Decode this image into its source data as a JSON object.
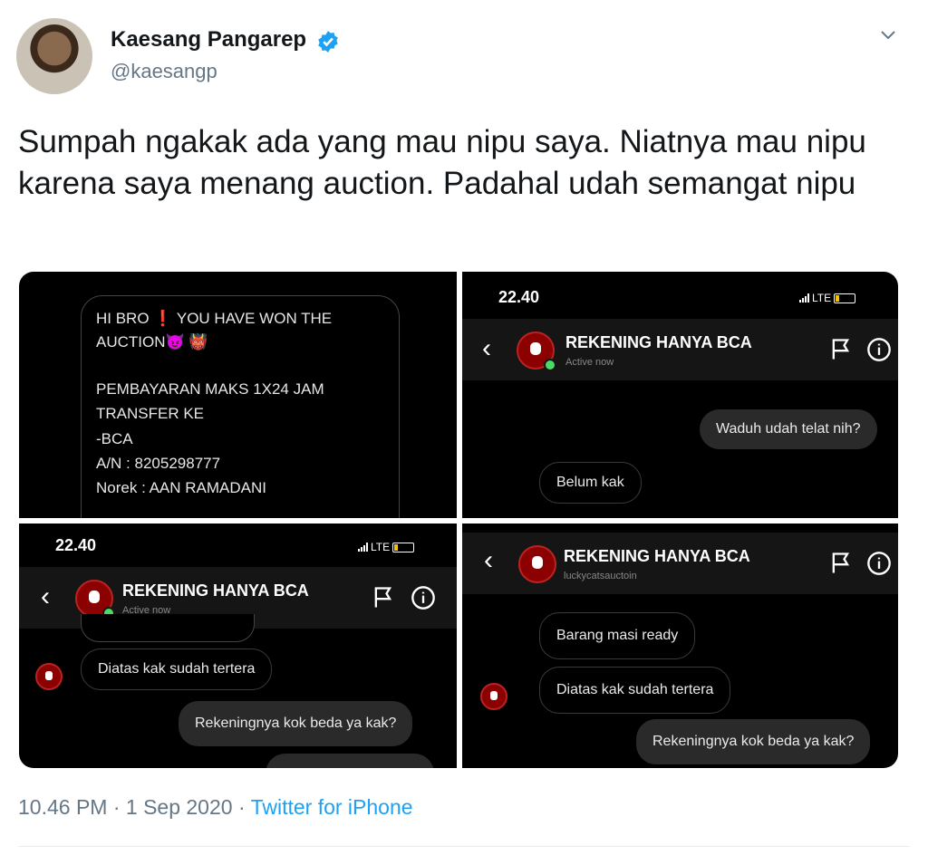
{
  "author": {
    "name": "Kaesang Pangarep",
    "handle": "@kaesangp"
  },
  "tweet": {
    "text": "Sumpah ngakak ada yang mau nipu saya. Niatnya mau nipu karena saya menang auction. Padahal udah semangat nipu"
  },
  "panel1": {
    "lines": [
      "HI BRO ❗ YOU HAVE WON THE",
      "AUCTION😈 👹",
      "PEMBAYARAN MAKS 1X24 JAM",
      "TRANSFER KE",
      "-BCA",
      "A/N : 8205298777",
      "Norek : AAN RAMADANI"
    ]
  },
  "panel2": {
    "time": "22.40",
    "network": "LTE",
    "chat_name": "REKENING HANYA BCA",
    "chat_sub": "Active now",
    "messages": [
      "Waduh udah telat nih?",
      "Belum kak"
    ]
  },
  "panel3": {
    "time": "22.40",
    "network": "LTE",
    "chat_name": "REKENING HANYA BCA",
    "chat_sub": "Active now",
    "messages": [
      "Diatas kak sudah tertera",
      "Rekeningnya kok beda ya kak?"
    ]
  },
  "panel4": {
    "chat_name": "REKENING HANYA BCA",
    "chat_sub": "luckycatsauctoin",
    "messages": [
      "Barang masi ready",
      "Diatas kak sudah tertera",
      "Rekeningnya kok beda ya kak?"
    ]
  },
  "footer": {
    "time": "10.46 PM · 1 Sep 2020 · ",
    "source": "Twitter for iPhone"
  },
  "colors": {
    "link": "#1da1f2",
    "verified": "#1da1f2",
    "secondary": "#657786"
  }
}
